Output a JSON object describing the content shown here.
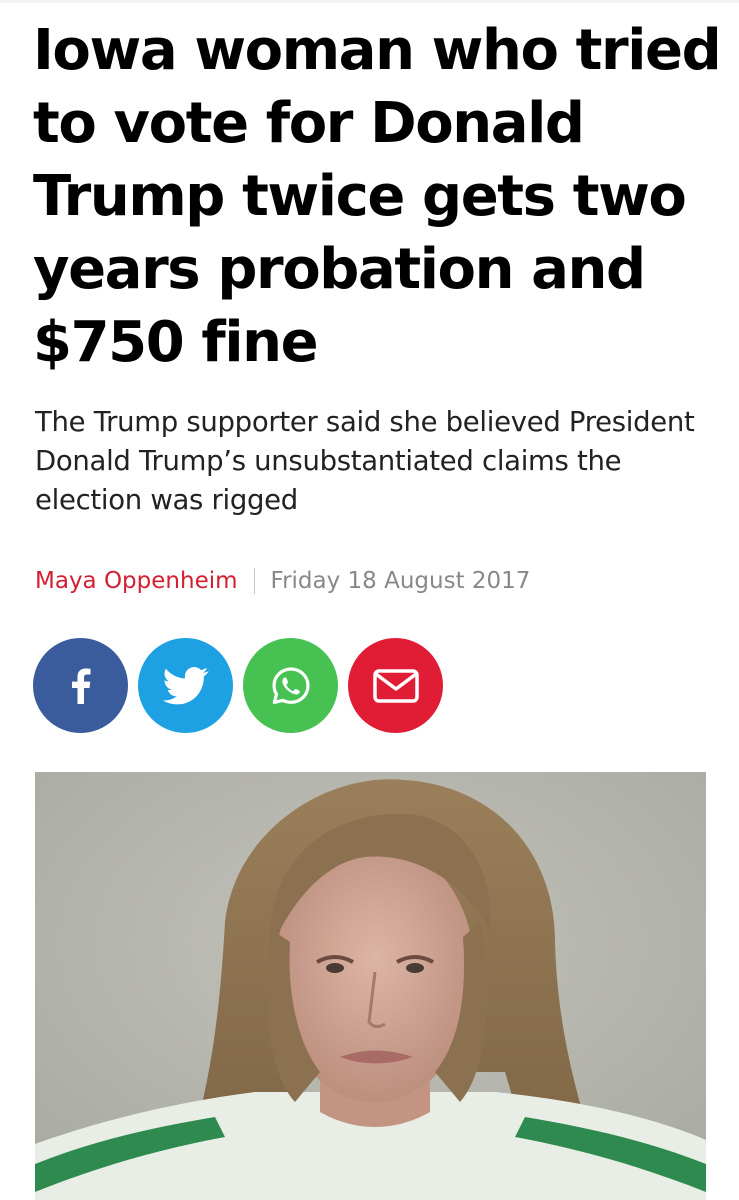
{
  "article": {
    "headline": "Iowa woman who tried to vote for Donald Trump twice gets two years probation and $750 fine",
    "standfirst": "The Trump supporter said she believed President Donald Trump’s unsubstantiated claims the election was rigged",
    "author": "Maya Oppenheim",
    "date": "Friday 18 August 2017"
  },
  "share": [
    {
      "name": "facebook",
      "icon": "facebook-icon",
      "color": "#3a5b9c"
    },
    {
      "name": "twitter",
      "icon": "twitter-icon",
      "color": "#1da1e2"
    },
    {
      "name": "whatsapp",
      "icon": "whatsapp-icon",
      "color": "#47c152"
    },
    {
      "name": "email",
      "icon": "mail-icon",
      "color": "#e11d35"
    }
  ],
  "colors": {
    "accent": "#d21f31",
    "date_text": "#888888"
  },
  "photo": {
    "subject": "mugshot-photo"
  }
}
